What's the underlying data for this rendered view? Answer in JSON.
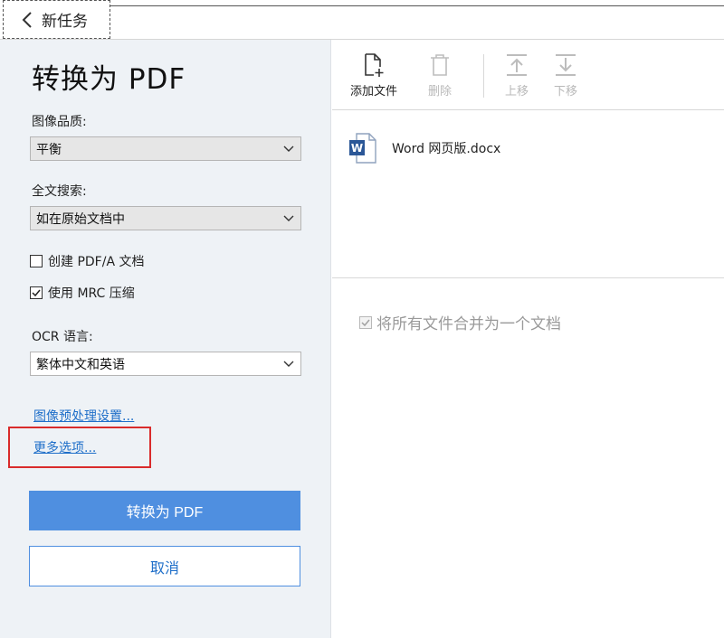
{
  "header": {
    "back_label": "新任务"
  },
  "settings": {
    "title": "转换为 PDF",
    "image_quality_label": "图像品质:",
    "image_quality_value": "平衡",
    "fulltext_label": "全文搜索:",
    "fulltext_value": "如在原始文档中",
    "pdfa_label": "创建 PDF/A 文档",
    "pdfa_checked": false,
    "mrc_label": "使用 MRC 压缩",
    "mrc_checked": true,
    "ocr_label": "OCR 语言:",
    "ocr_value": "繁体中文和英语",
    "preprocess_link": "图像预处理设置...",
    "more_options_link": "更多选项...",
    "convert_button": "转换为 PDF",
    "cancel_button": "取消"
  },
  "toolbar": {
    "add_file": "添加文件",
    "delete": "删除",
    "move_up": "上移",
    "move_down": "下移"
  },
  "files": [
    {
      "name": "Word 网页版.docx",
      "icon": "word-doc-icon"
    }
  ],
  "merge": {
    "label": "将所有文件合并为一个文档",
    "checked": true
  },
  "colors": {
    "primary": "#4f8fe0",
    "link": "#1f6fc9",
    "highlight": "#d92b2b",
    "panel_bg": "#eef2f6"
  }
}
